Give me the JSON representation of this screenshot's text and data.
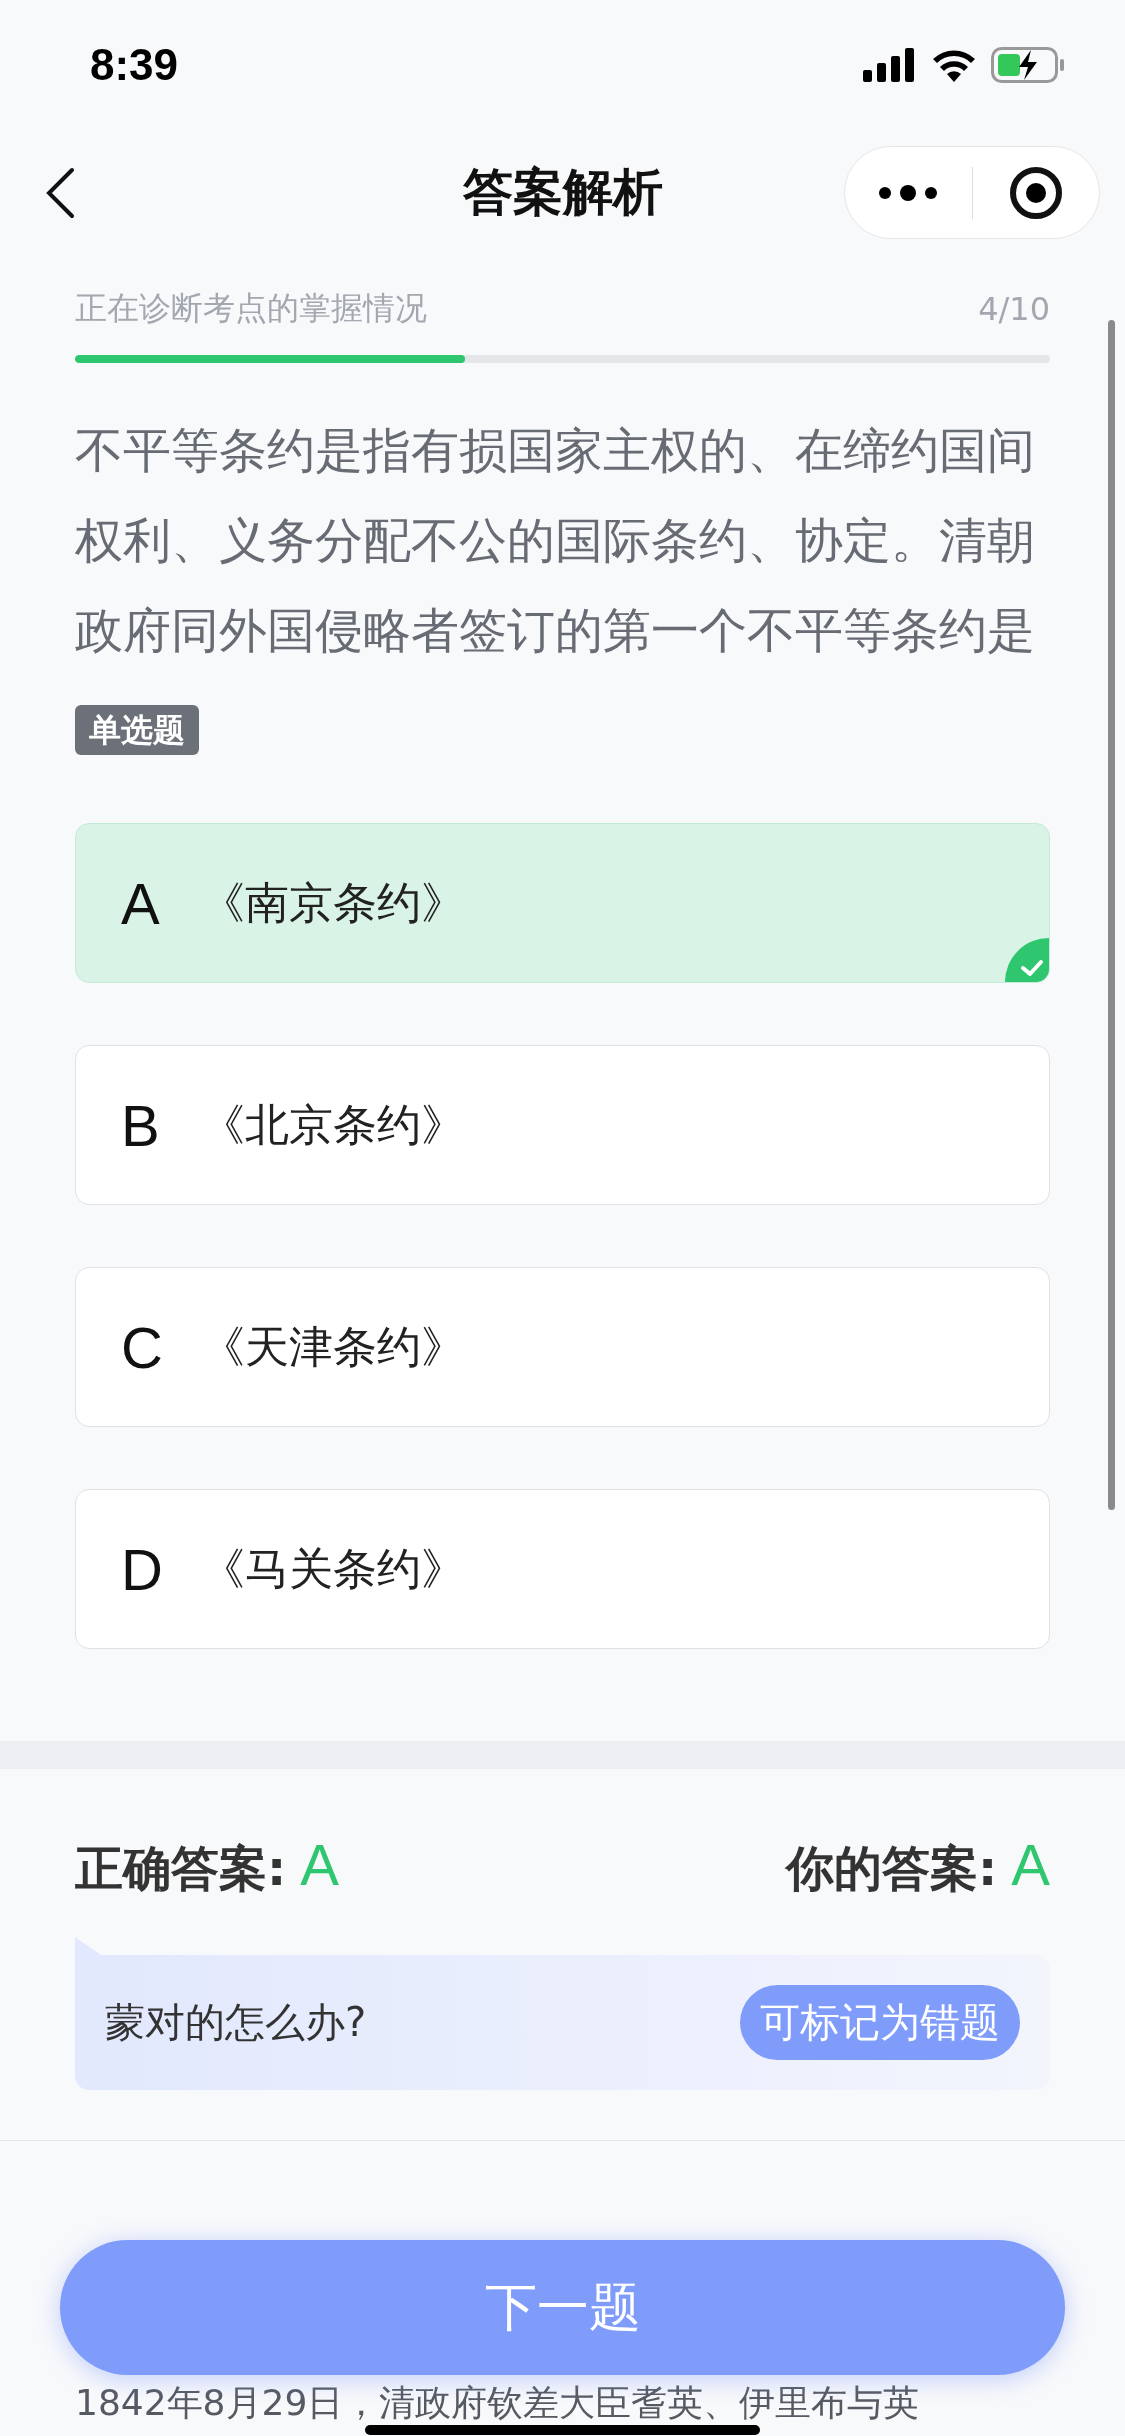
{
  "status_bar": {
    "time": "8:39"
  },
  "nav": {
    "title": "答案解析"
  },
  "progress": {
    "label": "正在诊断考点的掌握情况",
    "count": "4/10",
    "level": 0.4
  },
  "question": {
    "text": "不平等条约是指有损国家主权的、在缔约国间权利、义务分配不公的国际条约、协定。清朝政府同外国侵略者签订的第一个不平等条约是",
    "type_tag": "单选题"
  },
  "options": [
    {
      "letter": "A",
      "text": "《南京条约》",
      "selected": true
    },
    {
      "letter": "B",
      "text": "《北京条约》",
      "selected": false
    },
    {
      "letter": "C",
      "text": "《天津条约》",
      "selected": false
    },
    {
      "letter": "D",
      "text": "《马关条约》",
      "selected": false
    }
  ],
  "answers": {
    "correct_label": "正确答案:",
    "correct_value": "A",
    "your_label": "你的答案:",
    "your_value": "A"
  },
  "hint": {
    "text": "蒙对的怎么办?",
    "button": "可标记为错题"
  },
  "next_button": "下一题",
  "explanation": {
    "text": "1842年8月29日，清政府钦差大臣耆英、伊里布与英"
  }
}
